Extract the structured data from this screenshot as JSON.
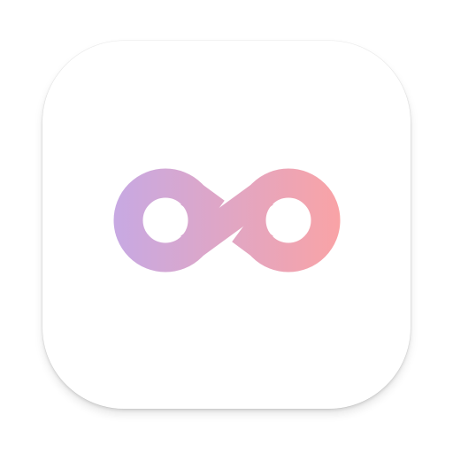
{
  "icon": {
    "name": "infinity-icon",
    "colors": {
      "tile_background": "#ffffff",
      "gradient_start": "#c7a9e3",
      "gradient_end": "#f9a3a6"
    }
  }
}
